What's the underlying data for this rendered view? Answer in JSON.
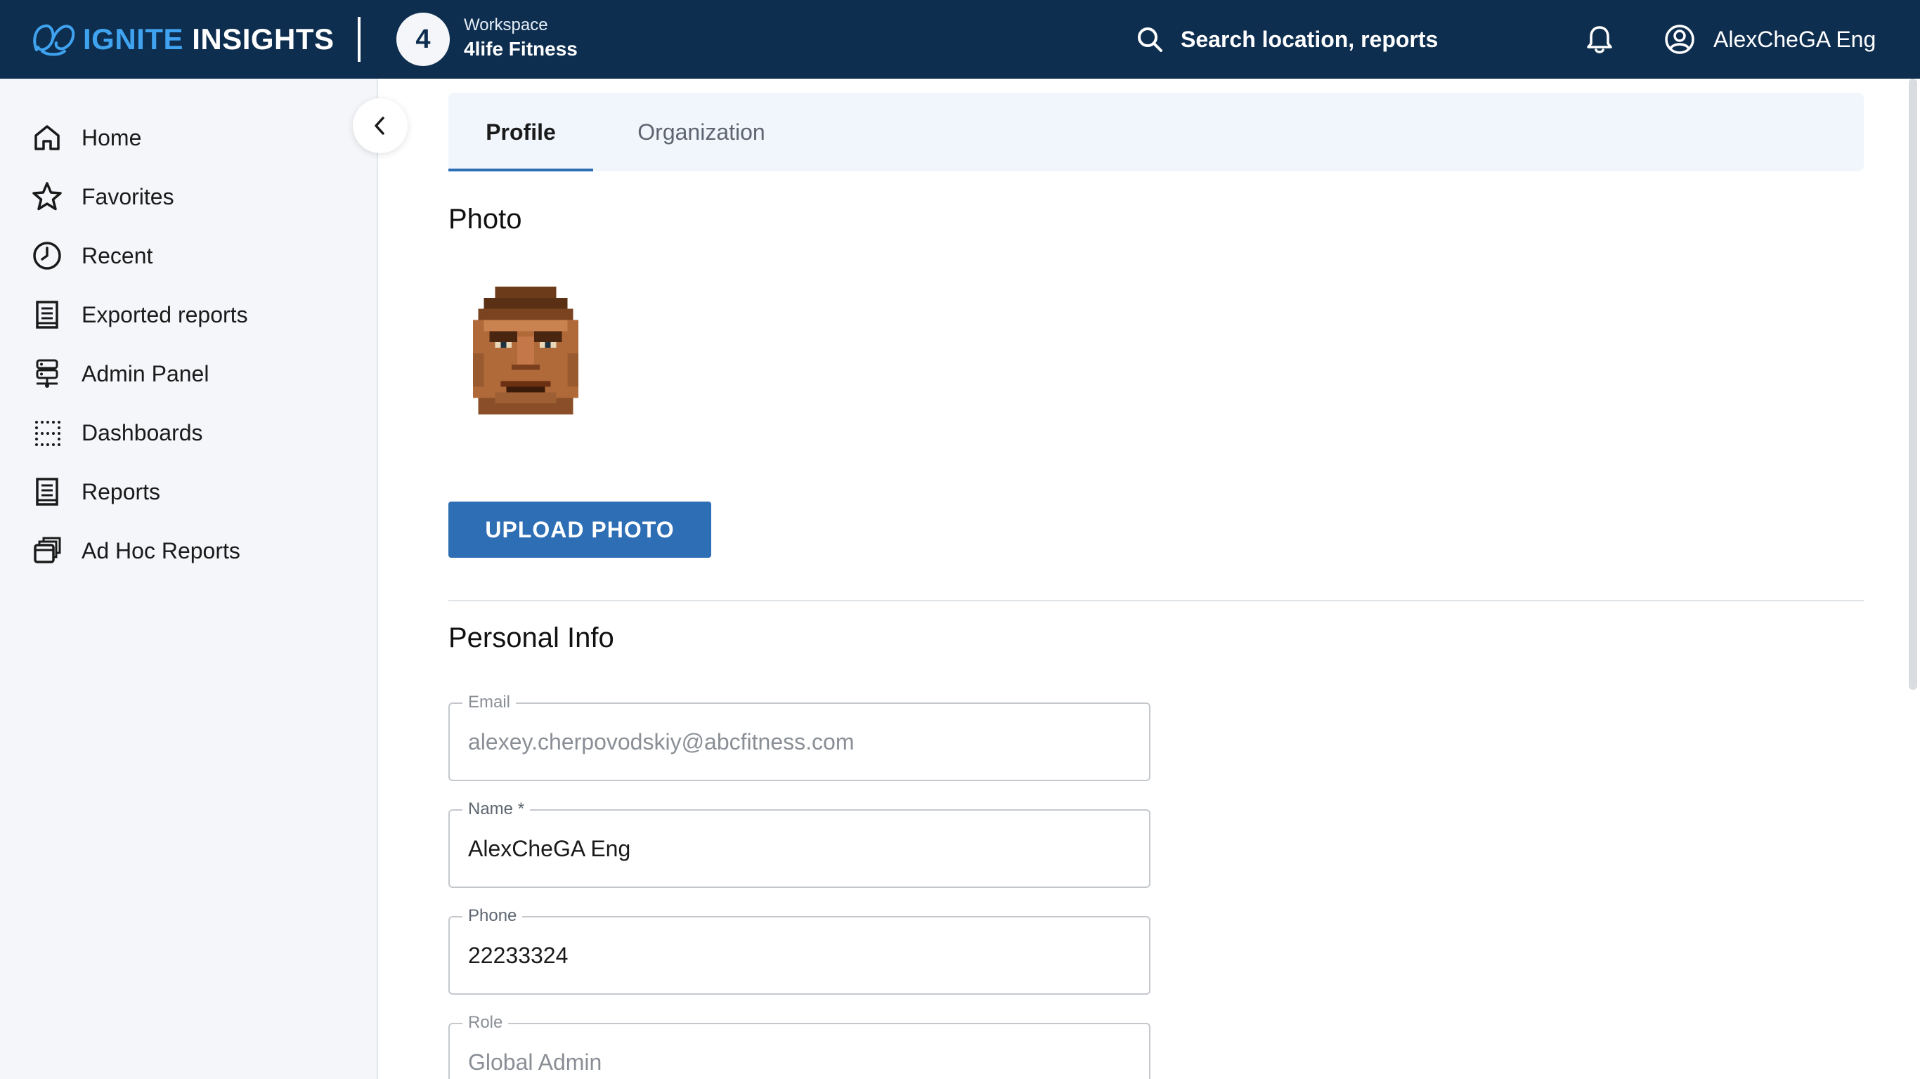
{
  "app": {
    "logo_part1": "IGNITE",
    "logo_part2": "INSIGHTS",
    "workspace_number": "4",
    "workspace_label": "Workspace",
    "workspace_name": "4life Fitness",
    "search_placeholder": "Search location, reports",
    "user_name": "AlexCheGA Eng"
  },
  "sidebar": {
    "items": [
      {
        "label": "Home",
        "icon": "home-icon"
      },
      {
        "label": "Favorites",
        "icon": "star-icon"
      },
      {
        "label": "Recent",
        "icon": "clock-icon"
      },
      {
        "label": "Exported reports",
        "icon": "receipt-icon"
      },
      {
        "label": "Admin Panel",
        "icon": "admin-server-icon"
      },
      {
        "label": "Dashboards",
        "icon": "dots-grid-icon"
      },
      {
        "label": "Reports",
        "icon": "report-icon"
      },
      {
        "label": "Ad Hoc Reports",
        "icon": "stacked-cards-icon"
      }
    ]
  },
  "tabs": [
    {
      "label": "Profile",
      "active": true
    },
    {
      "label": "Organization",
      "active": false
    }
  ],
  "profile": {
    "photo_title": "Photo",
    "upload_button": "UPLOAD PHOTO",
    "personal_info_title": "Personal Info",
    "fields": {
      "email": {
        "label": "Email",
        "value": "alexey.cherpovodskiy@abcfitness.com",
        "disabled": true
      },
      "name": {
        "label": "Name *",
        "value": "AlexCheGA Eng",
        "disabled": false
      },
      "phone": {
        "label": "Phone",
        "value": "22233324",
        "disabled": false
      },
      "role": {
        "label": "Role",
        "value": "Global Admin",
        "disabled": true
      }
    }
  },
  "colors": {
    "topbar_bg": "#0e2e4f",
    "accent": "#3fa3f0",
    "primary_button": "#2d6eb5",
    "sidebar_bg": "#f4f6f9",
    "tabs_bg": "#f0f6fc"
  }
}
